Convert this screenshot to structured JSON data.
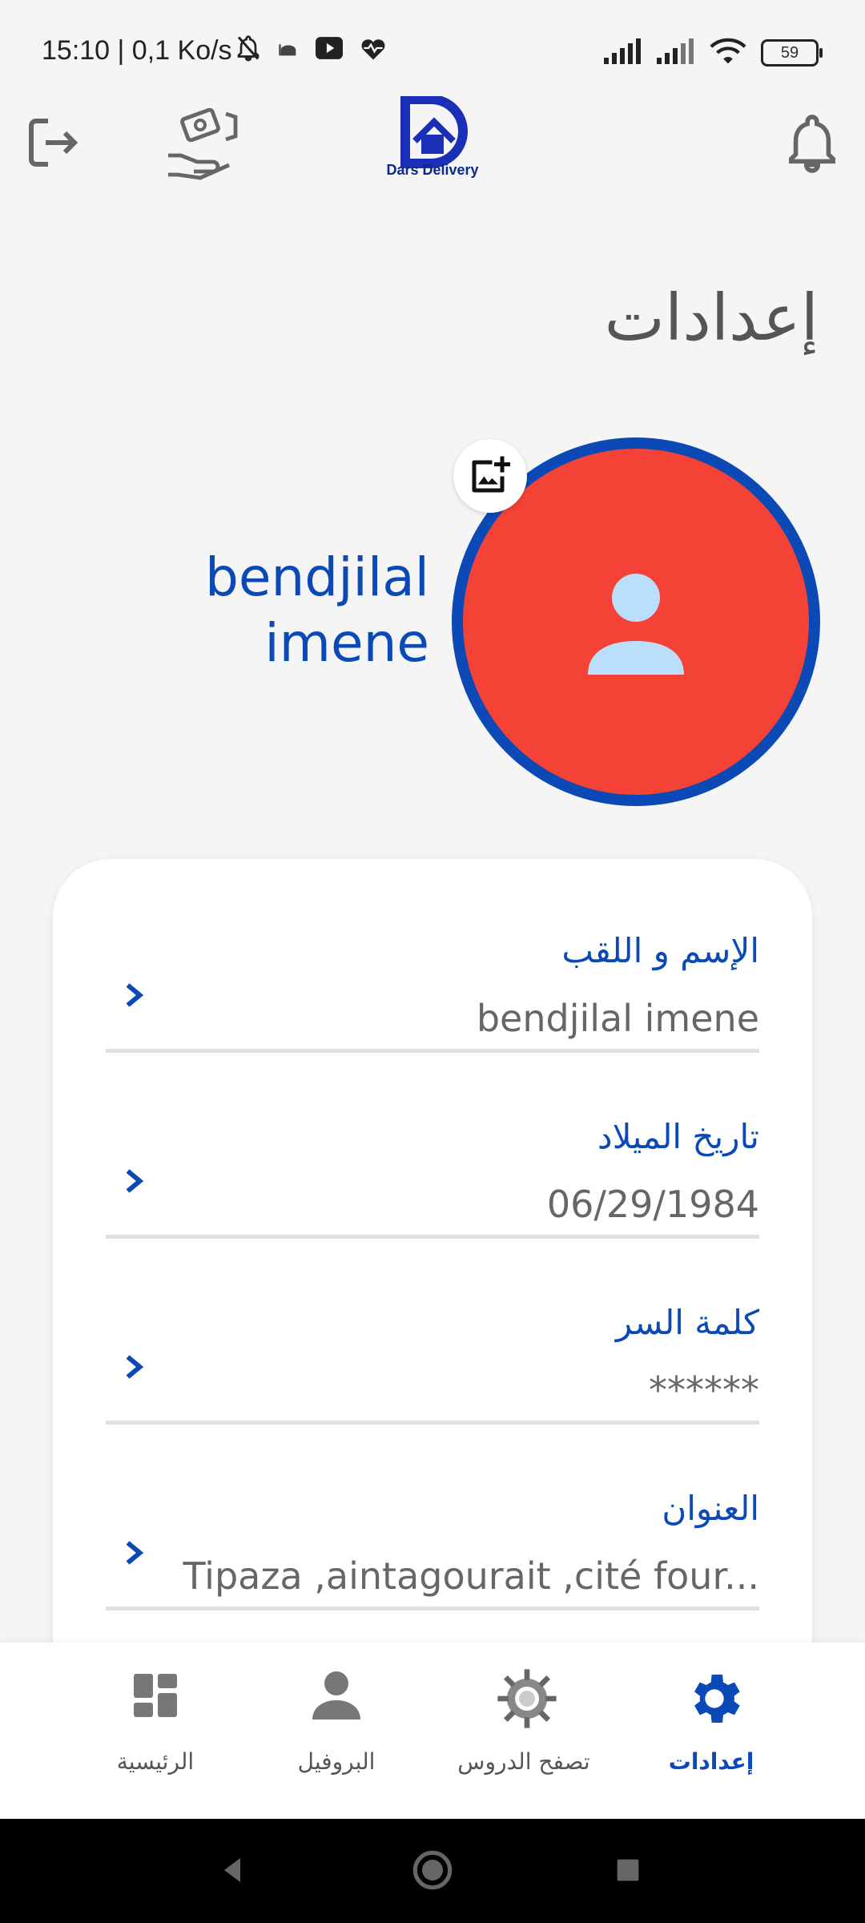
{
  "status_bar": {
    "time": "15:10 | 0,1 Ko/s",
    "battery": "59",
    "icons": [
      "mute-bell-icon",
      "mosque-icon",
      "youtube-icon",
      "heartbeat-icon",
      "signal-icon",
      "signal-icon",
      "wifi-icon",
      "battery-icon"
    ]
  },
  "header": {
    "logo_text": "Dars Delivery",
    "icons": [
      "logout-icon",
      "handshake-money-icon",
      "dars-delivery-logo",
      "bell-icon"
    ]
  },
  "page": {
    "title": "إعدادات"
  },
  "profile": {
    "name_line1": "bendjilal",
    "name_line2": "imene",
    "avatar_color": "#f44336",
    "ring_color": "#0a49b6"
  },
  "settings": [
    {
      "label": "الإسم و اللقب",
      "value": "bendjilal imene"
    },
    {
      "label": "تاريخ الميلاد",
      "value": "06/29/1984"
    },
    {
      "label": "كلمة السر",
      "value": "******"
    },
    {
      "label": "العنوان",
      "value": "Tipaza ,aintagourait ,cité four..."
    }
  ],
  "bottom_nav": [
    {
      "label": "الرئيسية",
      "icon": "dashboard-icon",
      "active": false
    },
    {
      "label": "البروفيل",
      "icon": "person-icon",
      "active": false
    },
    {
      "label": "تصفح الدروس",
      "icon": "gear-network-icon",
      "active": false
    },
    {
      "label": "إعدادات",
      "icon": "settings-gear-icon",
      "active": true
    }
  ],
  "colors": {
    "primary": "#0a49b6",
    "inactive": "#777777"
  }
}
